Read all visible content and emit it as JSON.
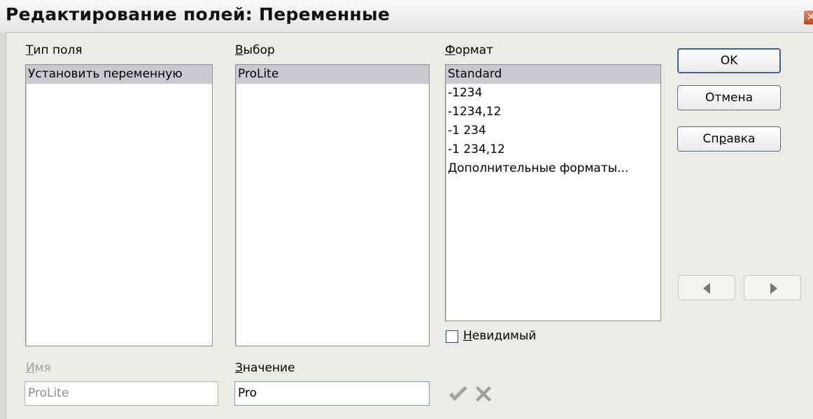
{
  "window": {
    "title": "Редактирование полей: Переменные"
  },
  "field_type": {
    "label_first": "Т",
    "label_rest": "ип поля",
    "items": [
      {
        "label": "Установить переменную",
        "selected": true
      }
    ]
  },
  "selection": {
    "label_first": "В",
    "label_rest": "ыбор",
    "items": [
      {
        "label": "ProLite",
        "selected": true
      }
    ]
  },
  "format": {
    "label_first": "Ф",
    "label_rest": "ормат",
    "items": [
      {
        "label": "Standard",
        "selected": true
      },
      {
        "label": "-1234",
        "selected": false
      },
      {
        "label": "-1234,12",
        "selected": false
      },
      {
        "label": "-1 234",
        "selected": false
      },
      {
        "label": "-1 234,12",
        "selected": false
      },
      {
        "label": "Дополнительные форматы...",
        "selected": false
      }
    ]
  },
  "invisible": {
    "label_first": "Н",
    "label_rest": "евидимый",
    "checked": false
  },
  "name": {
    "label_first": "И",
    "label_rest": "мя",
    "value": "ProLite",
    "disabled": true
  },
  "value": {
    "label_first": "З",
    "label_rest": "начение",
    "value": "Pro"
  },
  "buttons": {
    "ok": "OK",
    "cancel": "Отмена",
    "help_a": "Сп",
    "help_u": "р",
    "help_b": "авка"
  },
  "icons": {
    "close": "close-icon",
    "apply": "check-icon",
    "delete": "delete-x-icon",
    "prev": "arrow-left-icon",
    "next": "arrow-right-icon"
  },
  "colors": {
    "selection": "#c9c9cf",
    "dialog_bg": "#ecebe6",
    "default_border": "#3f5f9a",
    "icon_gray": "#9d9d9d"
  }
}
